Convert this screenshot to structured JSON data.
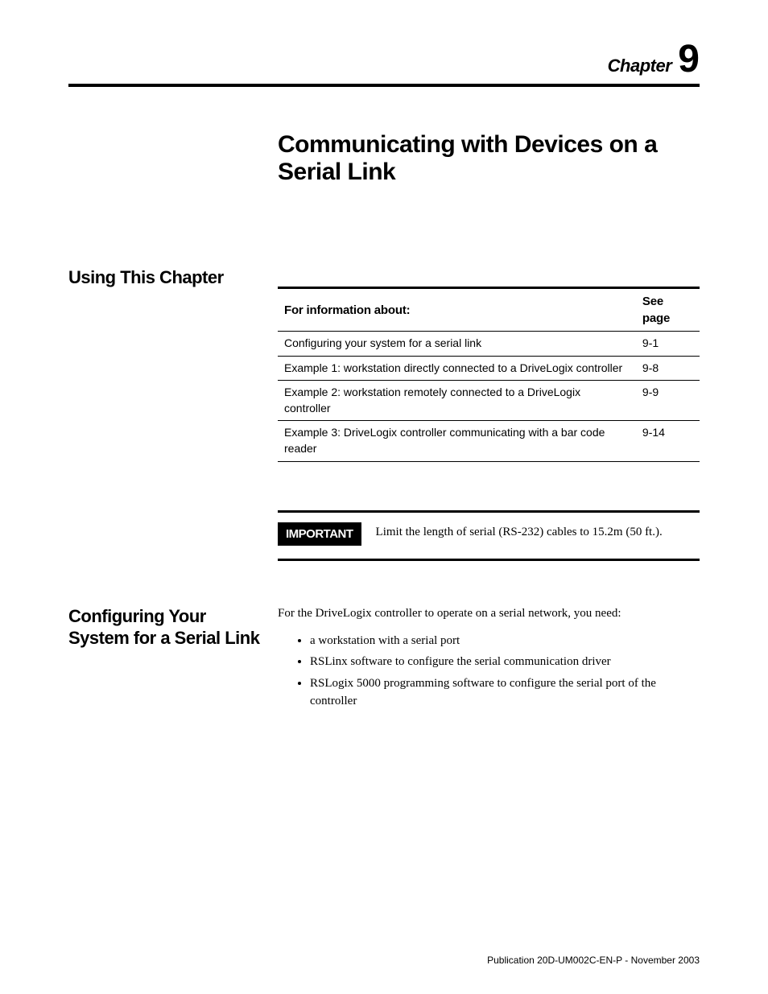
{
  "chapter": {
    "label": "Chapter",
    "number": "9"
  },
  "main_title": "Communicating with Devices on a Serial Link",
  "section_using": {
    "label": "Using This Chapter",
    "table": {
      "header_info": "For information about:",
      "header_page": "See page",
      "rows": [
        {
          "info": "Configuring your system for a serial link",
          "page": "9-1"
        },
        {
          "info": "Example 1: workstation directly connected to a DriveLogix controller",
          "page": "9-8"
        },
        {
          "info": "Example 2: workstation remotely connected to a DriveLogix controller",
          "page": "9-9"
        },
        {
          "info": "Example 3: DriveLogix controller communicating with a bar code reader",
          "page": "9-14"
        }
      ]
    },
    "important": {
      "badge": "IMPORTANT",
      "text": "Limit the length of serial (RS-232) cables to 15.2m (50 ft.)."
    }
  },
  "section_config": {
    "label": "Configuring Your System for a Serial Link",
    "intro": "For the DriveLogix controller to operate on a serial network, you need:",
    "bullets": [
      "a workstation with a serial port",
      "RSLinx software to configure the serial communication driver",
      "RSLogix 5000 programming software to configure the serial port of the controller"
    ]
  },
  "footer": "Publication 20D-UM002C-EN-P - November 2003"
}
